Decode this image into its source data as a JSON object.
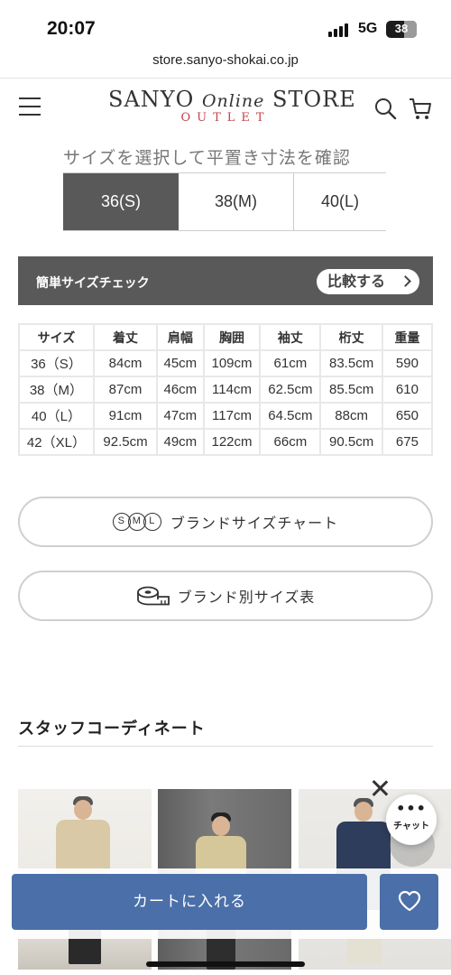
{
  "status_bar": {
    "time": "20:07",
    "network": "5G",
    "battery": "38"
  },
  "browser": {
    "url": "store.sanyo-shokai.co.jp"
  },
  "header": {
    "logo_left": "SANYO",
    "logo_mid": "Online",
    "logo_right": "STORE",
    "logo_sub": "OUTLET",
    "icons": [
      "menu-icon",
      "search-icon",
      "cart-icon"
    ]
  },
  "size_selector": {
    "title": "サイズを選択して平置き寸法を確認",
    "tabs": [
      "36(S)",
      "38(M)",
      "40(L)"
    ],
    "selected": "36(S)"
  },
  "size_check": {
    "label": "簡単サイズチェック",
    "compare_label": "比較する"
  },
  "size_table": {
    "headers": [
      "サイズ",
      "着丈",
      "肩幅",
      "胸囲",
      "袖丈",
      "桁丈",
      "重量"
    ],
    "rows": [
      [
        "36（S）",
        "84cm",
        "45cm",
        "109cm",
        "61cm",
        "83.5cm",
        "590"
      ],
      [
        "38（M）",
        "87cm",
        "46cm",
        "114cm",
        "62.5cm",
        "85.5cm",
        "610"
      ],
      [
        "40（L）",
        "91cm",
        "47cm",
        "117cm",
        "64.5cm",
        "88cm",
        "650"
      ],
      [
        "42（XL）",
        "92.5cm",
        "49cm",
        "122cm",
        "66cm",
        "90.5cm",
        "675"
      ]
    ]
  },
  "buttons": {
    "brand_size_chart": "ブランドサイズチャート",
    "sml": [
      "S",
      "M",
      "L"
    ],
    "brand_size_table": "ブランド別サイズ表"
  },
  "staff": {
    "title": "スタッフコーディネート"
  },
  "chat": {
    "dots": "•••",
    "label": "チャット"
  },
  "actions": {
    "add_to_cart": "カートに入れる"
  },
  "colors": {
    "accent_blue": "#4b6fa8",
    "tab_active": "#595959",
    "logo_red": "#c0444a"
  }
}
